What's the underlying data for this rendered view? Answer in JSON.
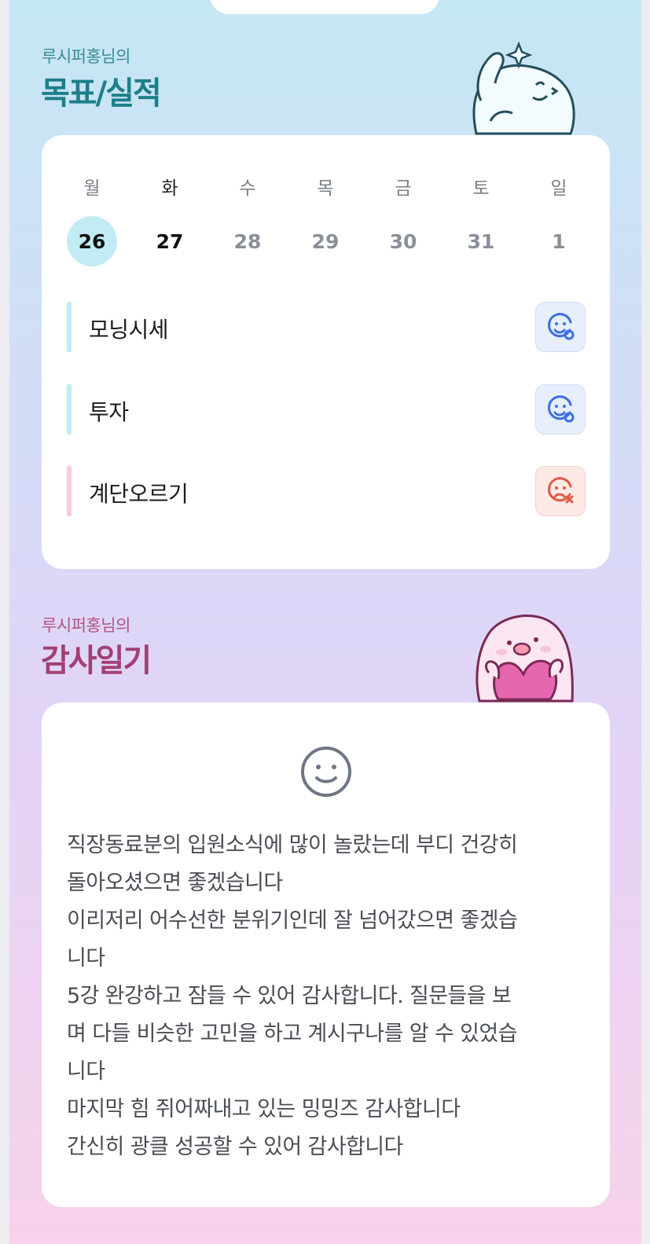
{
  "header": {
    "pill_text": ""
  },
  "goals_section": {
    "owner": "루시퍼홍님의",
    "title": "목표/실적",
    "calendar": {
      "day_names": [
        "월",
        "화",
        "수",
        "목",
        "금",
        "토",
        "일"
      ],
      "dates": [
        "26",
        "27",
        "28",
        "29",
        "30",
        "31",
        "1"
      ],
      "selected_index": 0
    },
    "goals": [
      {
        "label": "모닝시세",
        "status": "success",
        "status_icon": "smile-check-icon",
        "bar_color": "#c2ecf4"
      },
      {
        "label": "투자",
        "status": "success",
        "status_icon": "smile-check-icon",
        "bar_color": "#c2ecf4"
      },
      {
        "label": "계단오르기",
        "status": "fail",
        "status_icon": "sad-x-icon",
        "bar_color": "#f9c8e4"
      }
    ]
  },
  "gratitude_section": {
    "owner": "루시퍼홍님의",
    "title": "감사일기",
    "mood_icon": "smile-face-icon",
    "lines": [
      "직장동료분의 입원소식에 많이 놀랐는데 부디 건강히",
      "돌아오셨으면 좋겠습니다",
      "이리저리 어수선한 분위기인데 잘 넘어갔으면 좋겠습",
      "니다",
      "5강 완강하고 잠들 수 있어 감사합니다. 질문들을 보",
      "며 다들 비슷한 고민을 하고 계시구나를 알 수 있었습",
      "니다",
      "마지막 힘 쥐어짜내고 있는 밍밍즈 감사합니다",
      "간신히 광클 성공할 수 있어 감사합니다"
    ]
  },
  "colors": {
    "goal_title": "#1d7f89",
    "gratitude_title": "#a23f73",
    "selected_date_bg": "#c2ecf4",
    "success_icon": "#3d6fe0",
    "fail_icon": "#e15a45"
  }
}
